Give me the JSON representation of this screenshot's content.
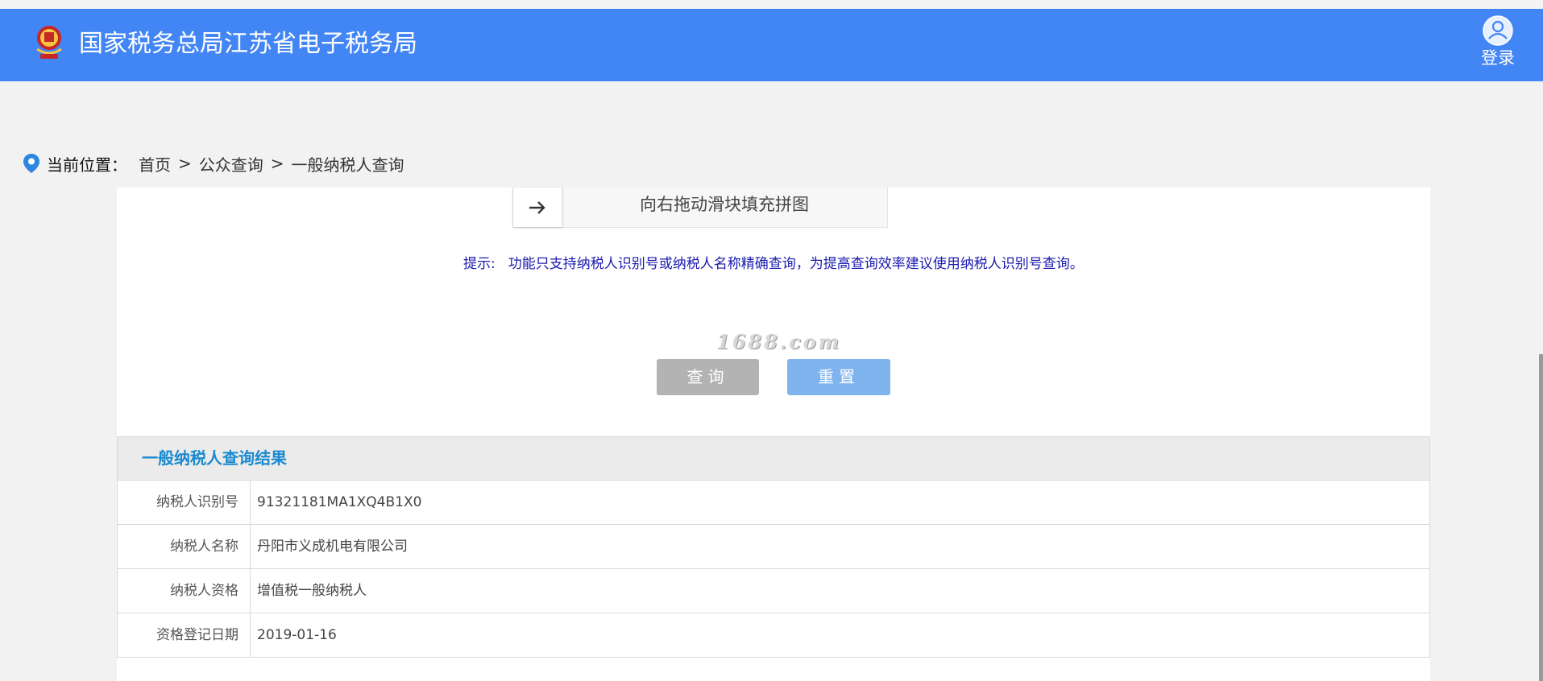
{
  "header": {
    "site_title": "国家税务总局江苏省电子税务局",
    "login_label": "登录",
    "brand_color": "#4285f4"
  },
  "breadcrumb": {
    "label": "当前位置：",
    "items": [
      "首页",
      "公众查询",
      "一般纳税人查询"
    ],
    "separator": ">"
  },
  "slider": {
    "arrow_icon": "arrow-right-icon",
    "text": "向右拖动滑块填充拼图"
  },
  "hint": {
    "label": "提示:",
    "text": "功能只支持纳税人识别号或纳税人名称精确查询，为提高查询效率建议使用纳税人识别号查询。"
  },
  "watermark": "1688.com",
  "buttons": {
    "query": "查询",
    "reset": "重置"
  },
  "results": {
    "title": "一般纳税人查询结果",
    "rows": [
      {
        "label": "纳税人识别号",
        "value": "91321181MA1XQ4B1X0"
      },
      {
        "label": "纳税人名称",
        "value": "丹阳市义成机电有限公司"
      },
      {
        "label": "纳税人资格",
        "value": "增值税一般纳税人"
      },
      {
        "label": "资格登记日期",
        "value": "2019-01-16"
      }
    ]
  }
}
